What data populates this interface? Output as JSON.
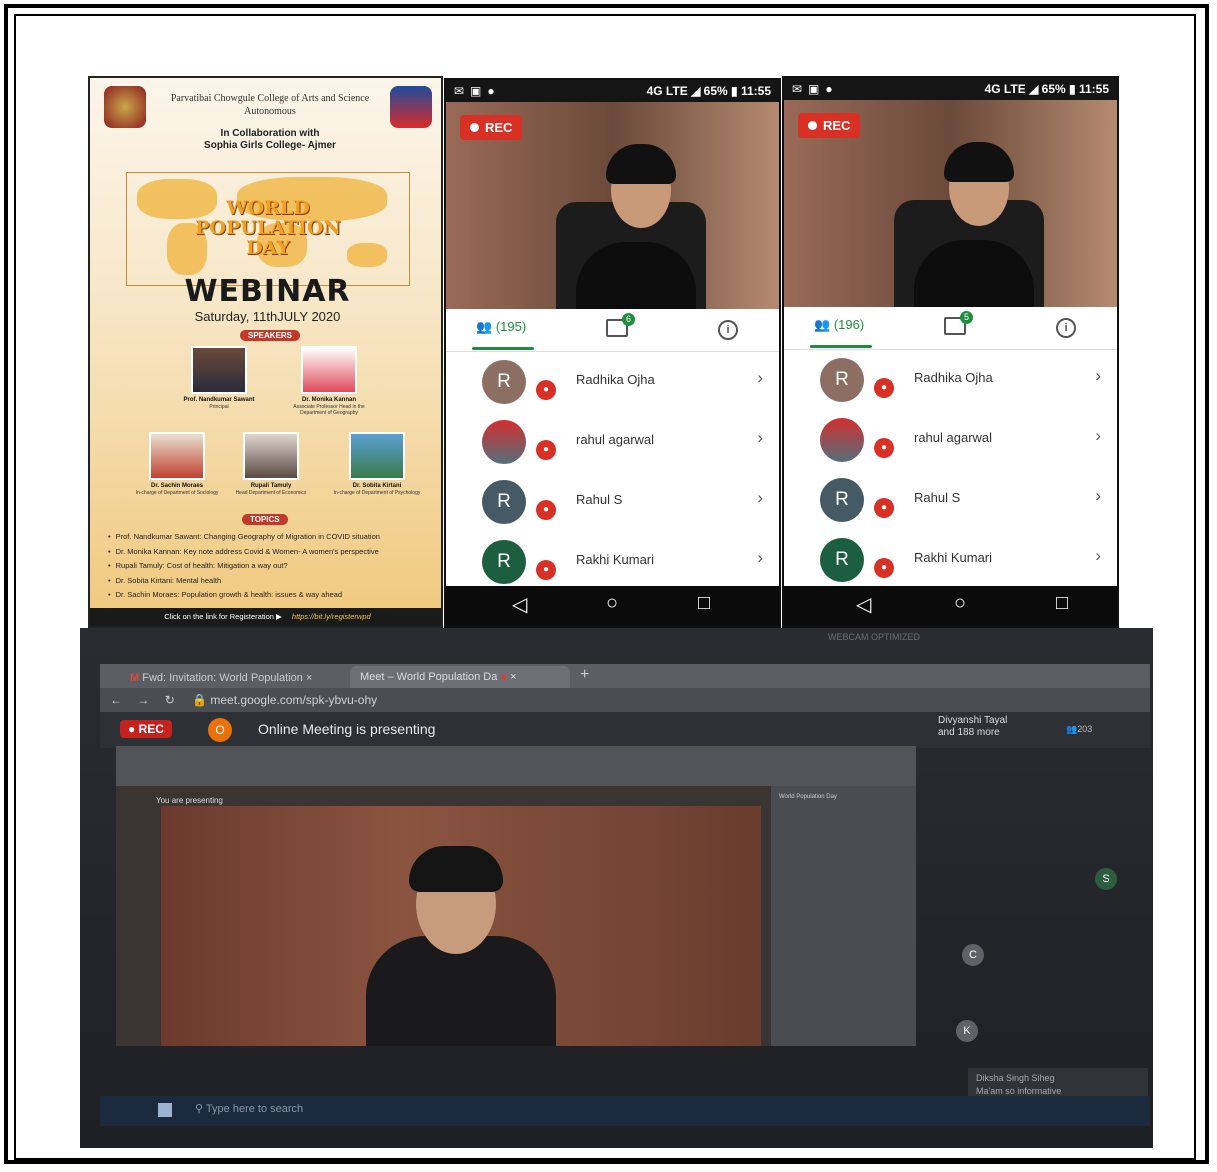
{
  "poster": {
    "college": "Parvatibai Chowgule College of Arts and Science",
    "autonomous": "Autonomous",
    "collab_line1": "In Collaboration with",
    "collab_line2": "Sophia Girls College- Ajmer",
    "event_line1": "WORLD",
    "event_line2": "POPULATION",
    "event_line3": "DAY",
    "webinar": "WEBINAR",
    "date": "Saturday, 11thJULY 2020",
    "speakers_label": "SPEAKERS",
    "topics_label": "TOPICS",
    "speakers": [
      {
        "name": "Prof. Nandkumar Sawant",
        "role": "Principal"
      },
      {
        "name": "Dr. Monika Kannan",
        "role": "Associate Professor Head in the Department of Geography"
      },
      {
        "name": "Dr. Sachin Moraes",
        "role": "In-charge of Department of Sociology"
      },
      {
        "name": "Rupali Tamuly",
        "role": "Head Department of Economics"
      },
      {
        "name": "Dr. Sobita Kirtani",
        "role": "In-charge of Department of Psychology"
      }
    ],
    "topics": [
      "Prof. Nandkumar Sawant: Changing Geography of Migration in COVID situation",
      "Dr. Monika Kannan: Key note address Covid & Women- A women's perspective",
      "Rupali Tamuly: Cost of health: Mitigation a way out?",
      "Dr. Sobita Kirtani: Mental health",
      "Dr. Sachin Moraes: Population growth & health: issues & way ahead"
    ],
    "footer_text": "Click on the link for Registeration",
    "footer_link": "https://bit.ly/registerwpd"
  },
  "phone1": {
    "status_battery": "65%",
    "status_time": "11:55",
    "status_network": "4G LTE",
    "rec_label": "REC",
    "people_count": "(195)",
    "chat_badge": "6",
    "participants": [
      {
        "initial": "R",
        "name": "Radhika Ojha",
        "color": "#8d6e63"
      },
      {
        "initial": "",
        "name": "rahul agarwal",
        "color": "#546e7a"
      },
      {
        "initial": "R",
        "name": "Rahul S",
        "color": "#455a64"
      },
      {
        "initial": "R",
        "name": "Rakhi Kumari",
        "color": "#1b5e40"
      }
    ]
  },
  "phone2": {
    "status_battery": "65%",
    "status_time": "11:55",
    "status_network": "4G LTE",
    "rec_label": "REC",
    "people_count": "(196)",
    "chat_badge": "5",
    "participants": [
      {
        "initial": "R",
        "name": "Radhika Ojha",
        "color": "#8d6e63"
      },
      {
        "initial": "",
        "name": "rahul agarwal",
        "color": "#546e7a"
      },
      {
        "initial": "R",
        "name": "Rahul S",
        "color": "#455a64"
      },
      {
        "initial": "R",
        "name": "Rakhi Kumari",
        "color": "#1b5e40"
      }
    ]
  },
  "laptop": {
    "tab1": "Fwd: Invitation: World Population",
    "tab2": "Meet – World Population Da",
    "url": "meet.google.com/spk-ybvu-ohy",
    "rec_label": "REC",
    "presenter_initial": "O",
    "presenting": "Online Meeting is presenting",
    "host_line1": "Divyanshi Tayal",
    "host_line2": "and 188 more",
    "people_count": "203",
    "inner_presenting": "You are presenting",
    "side_title": "World Population Day",
    "search_placeholder": "Type here to search",
    "toast_name": "Diksha Singh Siheg",
    "toast_msg": "Ma'am so informative",
    "tile_s": "S",
    "tile_c": "C",
    "tile_k": "K",
    "webcam_label": "WEBCAM OPTIMIZED"
  },
  "colors": {
    "accent_green": "#1e8e3e",
    "rec_red": "#d93025",
    "poster_gold": "#f0b04a"
  }
}
